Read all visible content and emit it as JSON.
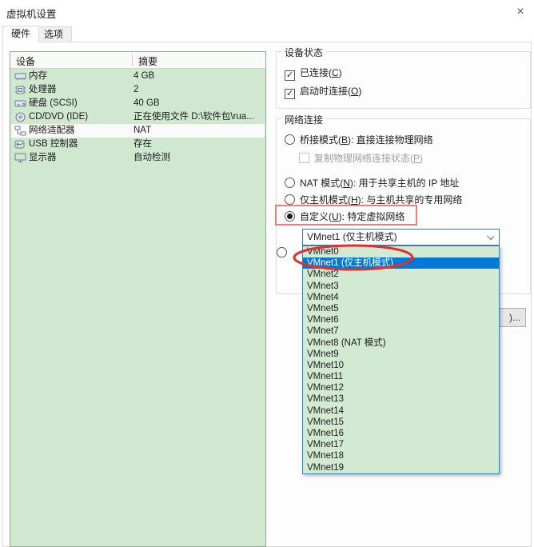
{
  "window": {
    "title": "虚拟机设置",
    "close_glyph": "×"
  },
  "tabs": [
    {
      "label": "硬件"
    },
    {
      "label": "选项"
    }
  ],
  "device_table": {
    "columns": {
      "device": "设备",
      "summary": "摘要"
    },
    "rows": [
      {
        "icon": "memory-icon",
        "device": "内存",
        "summary": "4 GB"
      },
      {
        "icon": "processor-icon",
        "device": "处理器",
        "summary": "2"
      },
      {
        "icon": "harddisk-icon",
        "device": "硬盘 (SCSI)",
        "summary": "40 GB"
      },
      {
        "icon": "cd-dvd-icon",
        "device": "CD/DVD (IDE)",
        "summary": "正在使用文件 D:\\软件包\\rua..."
      },
      {
        "icon": "network-adapter-icon",
        "device": "网络适配器",
        "summary": "NAT",
        "selected": true
      },
      {
        "icon": "usb-icon",
        "device": "USB 控制器",
        "summary": "存在"
      },
      {
        "icon": "display-icon",
        "device": "显示器",
        "summary": "自动检测"
      }
    ]
  },
  "device_status": {
    "title": "设备状态",
    "connected": {
      "label": "已连接(C)",
      "checked": true
    },
    "connect_at_power_on": {
      "label": "启动时连接(O)",
      "checked": true
    }
  },
  "network_connection": {
    "title": "网络连接",
    "bridged": {
      "label": "桥接模式(B): 直接连接物理网络",
      "selected": false
    },
    "replicate": {
      "label": "复制物理网络连接状态(P)",
      "checked": false,
      "disabled": true
    },
    "nat": {
      "label": "NAT 模式(N): 用于共享主机的 IP 地址",
      "selected": false
    },
    "host_only": {
      "label": "仅主机模式(H): 与主机共享的专用网络",
      "selected": false
    },
    "custom": {
      "label": "自定义(U): 特定虚拟网络",
      "selected": true,
      "annotated": "red-box"
    },
    "combobox_value": "VMnet1 (仅主机模式)"
  },
  "advanced_button_visible_text": ")...",
  "dropdown": {
    "selected_index": 1,
    "selected_annotation": "red-ellipse",
    "items": [
      "VMnet0",
      "VMnet1 (仅主机模式)",
      "VMnet2",
      "VMnet3",
      "VMnet4",
      "VMnet5",
      "VMnet6",
      "VMnet7",
      "VMnet8 (NAT 模式)",
      "VMnet9",
      "VMnet10",
      "VMnet11",
      "VMnet12",
      "VMnet13",
      "VMnet14",
      "VMnet15",
      "VMnet16",
      "VMnet17",
      "VMnet18",
      "VMnet19"
    ]
  },
  "colors": {
    "list_background": "#cfe8cf",
    "selection_blue": "#0078d7",
    "annotation_red": "#e03a3a",
    "annotation_box_red": "#e87f7f"
  }
}
